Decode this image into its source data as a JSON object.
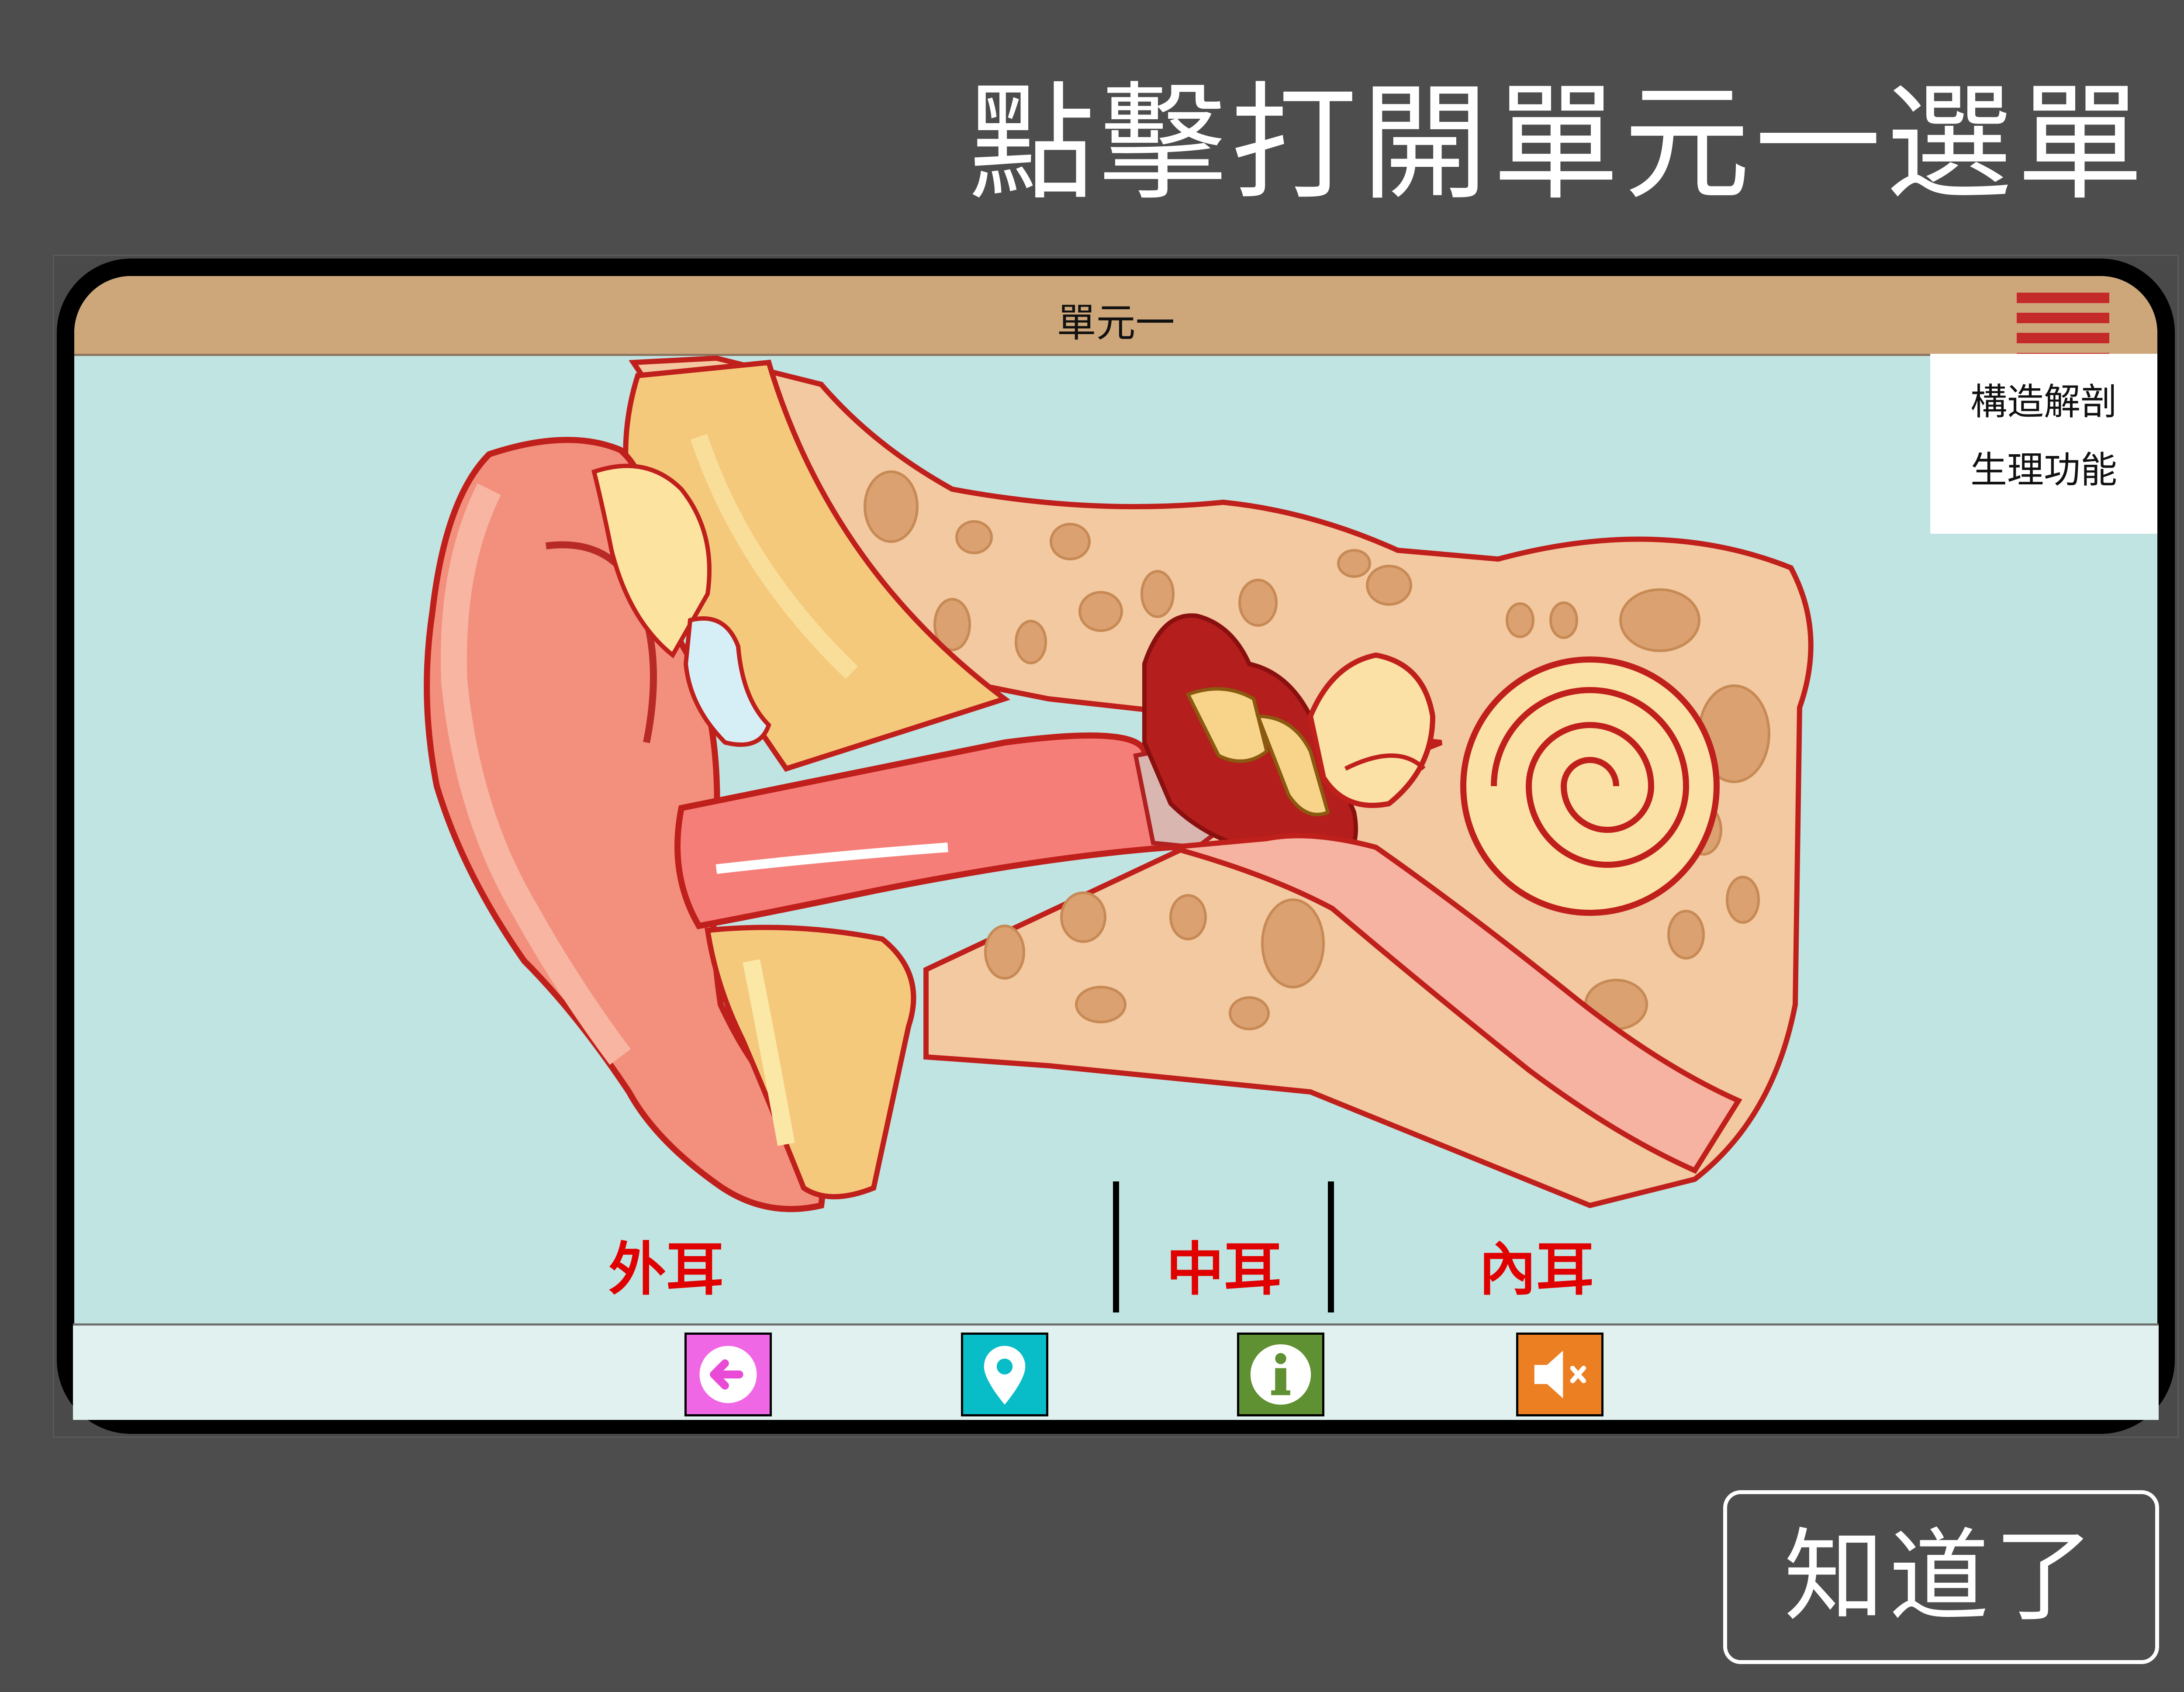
{
  "hint": {
    "title": "點擊打開單元一選單"
  },
  "app": {
    "title": "單元一"
  },
  "menu": {
    "icon": "hamburger-menu-icon",
    "items": [
      {
        "label": "構造解剖"
      },
      {
        "label": "生理功能"
      }
    ]
  },
  "diagram": {
    "labels": {
      "outer": "外耳",
      "middle": "中耳",
      "inner": "內耳"
    }
  },
  "toolbar": {
    "buttons": [
      {
        "icon": "back-arrow-icon",
        "color": "#f067e6"
      },
      {
        "icon": "location-pin-icon",
        "color": "#08bcc8"
      },
      {
        "icon": "info-icon",
        "color": "#5f9032"
      },
      {
        "icon": "speaker-muted-icon",
        "color": "#ec7f22"
      }
    ]
  },
  "dismiss": {
    "label": "知道了"
  },
  "colors": {
    "background": "#4d4d4d",
    "header": "#cda77a",
    "screen": "#c0e4e2",
    "label_red": "#e00000",
    "menu_bars": "#c52a2a"
  }
}
